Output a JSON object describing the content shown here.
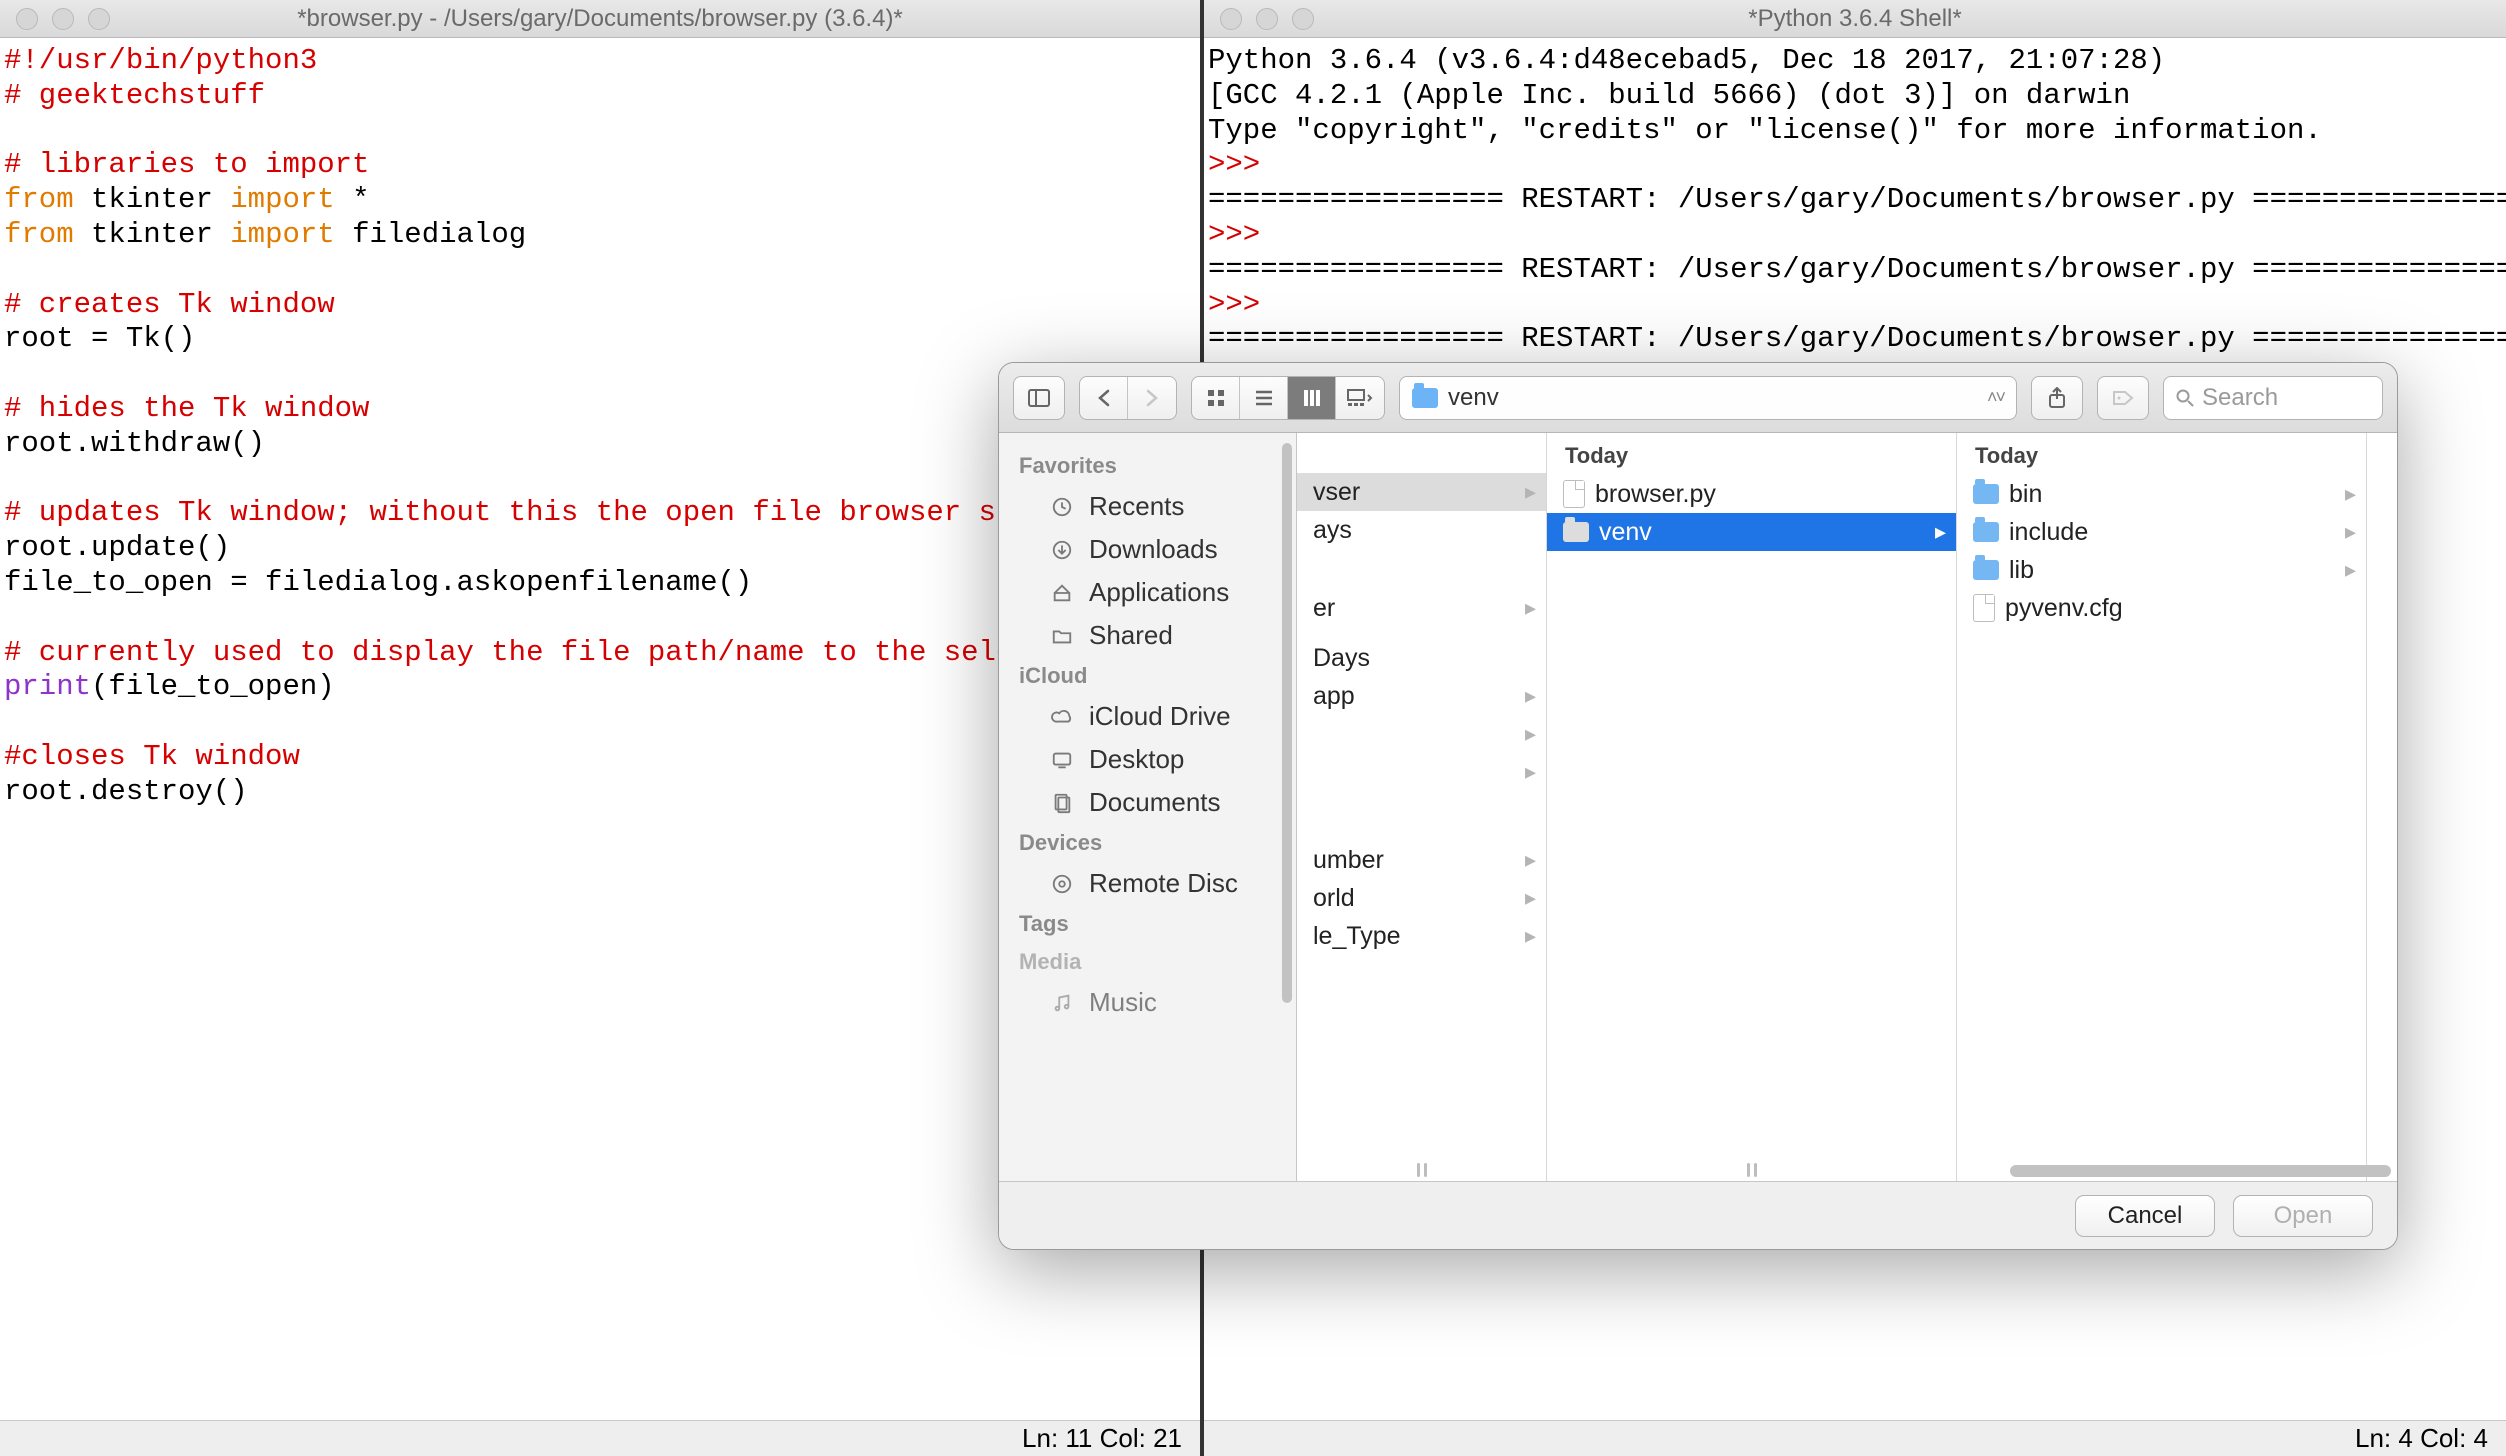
{
  "left_window": {
    "title": "*browser.py - /Users/gary/Documents/browser.py (3.6.4)*",
    "status": "Ln: 11  Col: 21",
    "code": {
      "l1": "#!/usr/bin/python3",
      "l2": "# geektechstuff",
      "l3": "# libraries to import",
      "l4_a": "from",
      "l4_b": " tkinter ",
      "l4_c": "import",
      "l4_d": " *",
      "l5_a": "from",
      "l5_b": " tkinter ",
      "l5_c": "import",
      "l5_d": " filedialog",
      "l6": "# creates Tk window",
      "l7": "root = Tk()",
      "l8": "# hides the Tk window",
      "l9": "root.withdraw()",
      "l10": "# updates Tk window; without this the open file browser stays open",
      "l11": "root.update()",
      "l12": "file_to_open = filedialog.askopenfilename()",
      "l13": "# currently used to display the file path/name to the selected file",
      "l14_a": "print",
      "l14_b": "(file_to_open)",
      "l15": "#closes Tk window",
      "l16": "root.destroy()"
    }
  },
  "right_window": {
    "title": "*Python 3.6.4 Shell*",
    "status": "Ln: 4  Col: 4",
    "lines": {
      "a": "Python 3.6.4 (v3.6.4:d48ecebad5, Dec 18 2017, 21:07:28)",
      "b": "[GCC 4.2.1 (Apple Inc. build 5666) (dot 3)] on darwin",
      "c": "Type \"copyright\", \"credits\" or \"license()\" for more information.",
      "p1": ">>>",
      "r1": "================= RESTART: /Users/gary/Documents/browser.py =================",
      "p2": ">>>",
      "r2": "================= RESTART: /Users/gary/Documents/browser.py =================",
      "p3": ">>>",
      "r3": "================= RESTART: /Users/gary/Documents/browser.py ================="
    }
  },
  "dialog": {
    "path_current": "venv",
    "search_placeholder": "Search",
    "buttons": {
      "cancel": "Cancel",
      "open": "Open"
    },
    "sidebar": {
      "sections": {
        "fav": "Favorites",
        "icloud": "iCloud",
        "devices": "Devices",
        "tags": "Tags",
        "media": "Media"
      },
      "items": {
        "recents": "Recents",
        "downloads": "Downloads",
        "applications": "Applications",
        "shared": "Shared",
        "iclouddrive": "iCloud Drive",
        "desktop": "Desktop",
        "documents": "Documents",
        "remotedisc": "Remote Disc",
        "music": "Music"
      }
    },
    "col1": {
      "rows": {
        "r1": "vser",
        "r2": "ays",
        "r3": "er",
        "r4": "Days",
        "r5": "app",
        "r6": "umber",
        "r7": "orld",
        "r8": "le_Type"
      }
    },
    "col2": {
      "header": "Today",
      "rows": {
        "r1": "browser.py",
        "r2": "venv"
      }
    },
    "col3": {
      "header": "Today",
      "rows": {
        "r1": "bin",
        "r2": "include",
        "r3": "lib",
        "r4": "pyvenv.cfg"
      }
    }
  }
}
